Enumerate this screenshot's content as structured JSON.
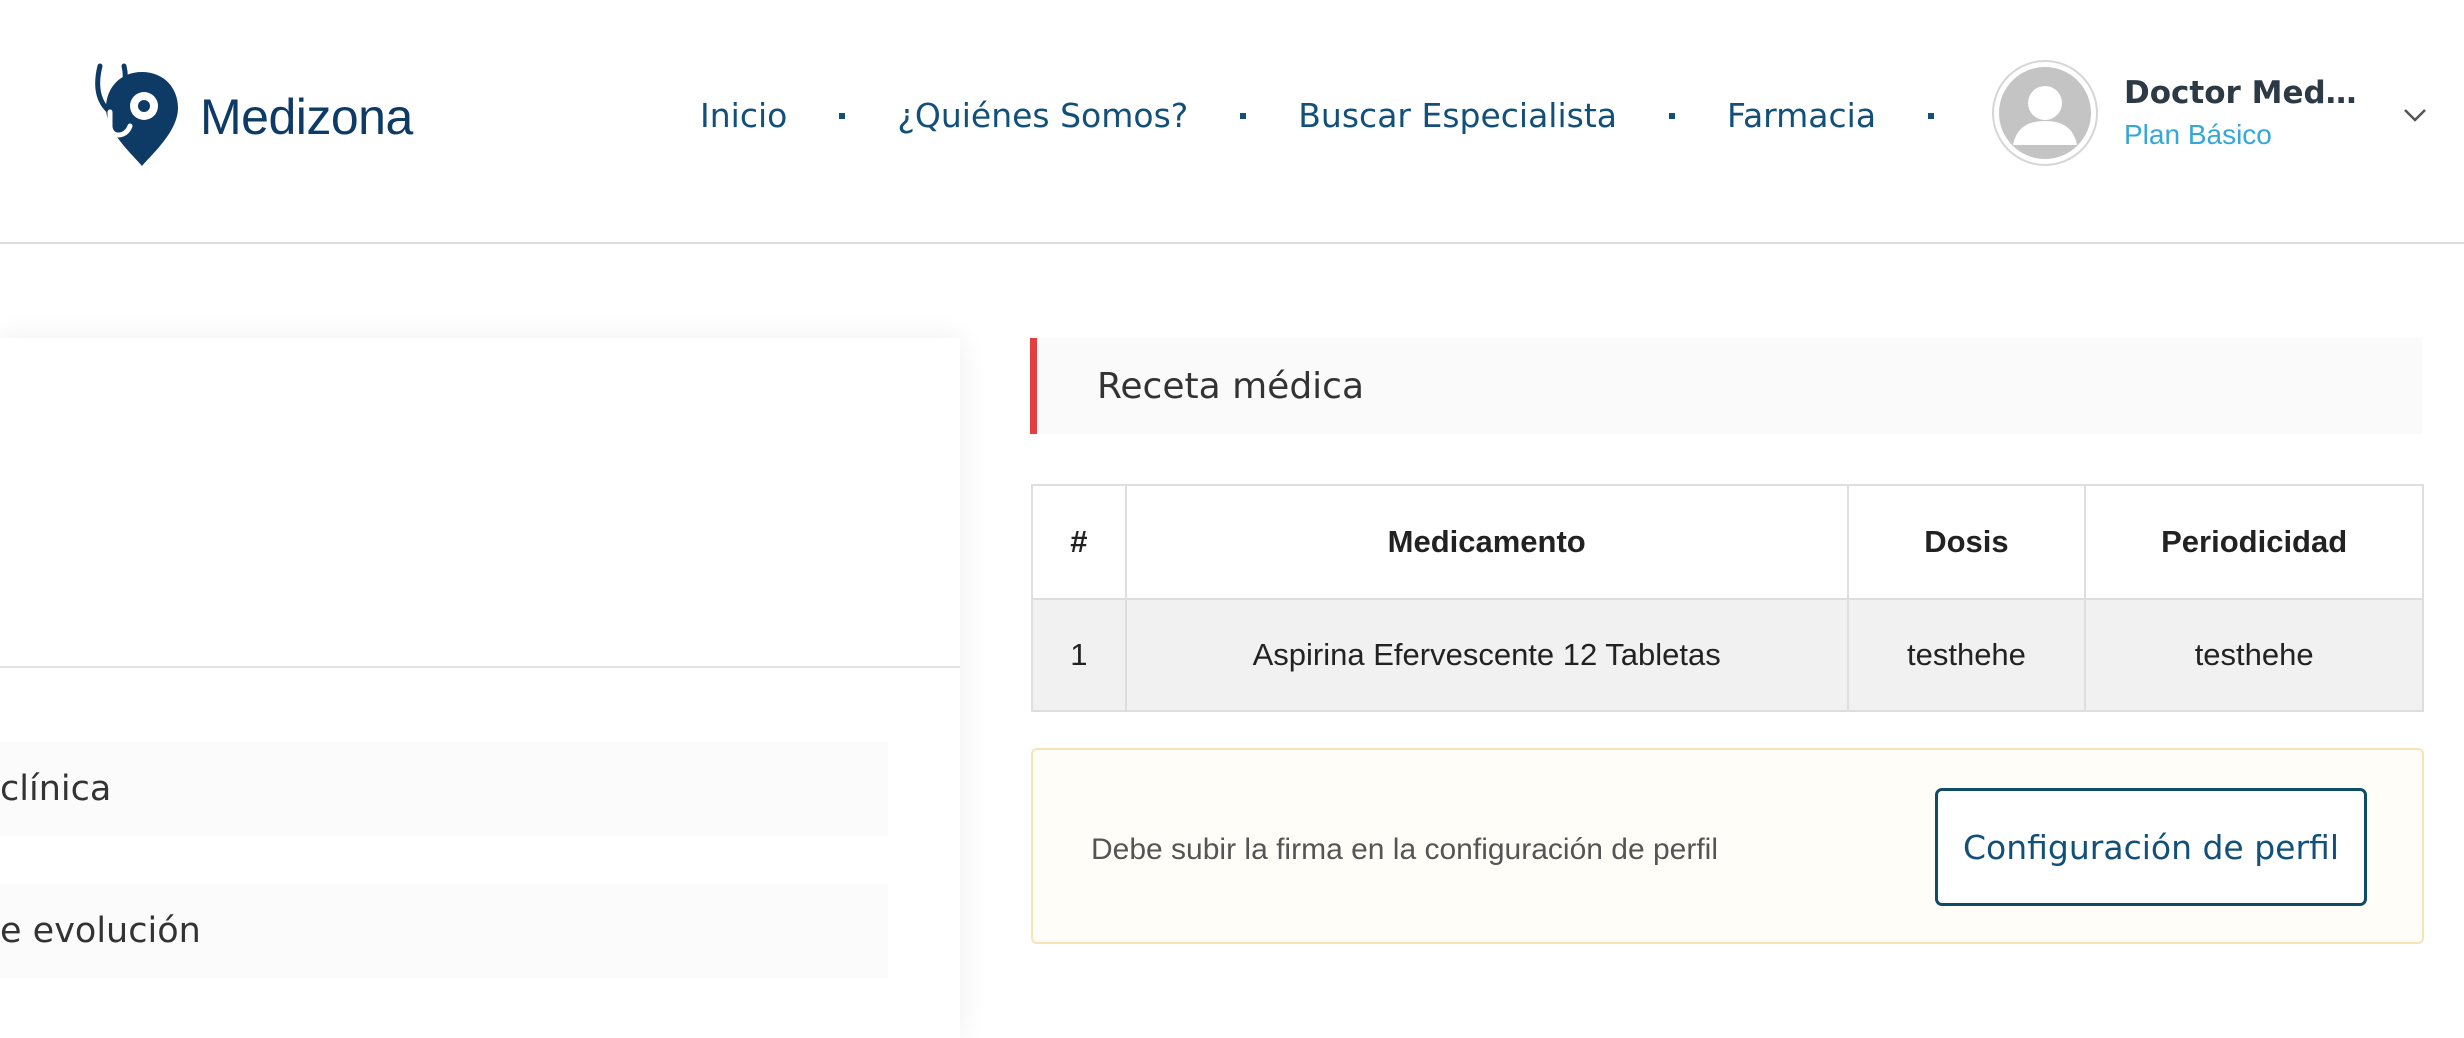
{
  "brand": {
    "name": "Medizona"
  },
  "nav": {
    "items": [
      "Inicio",
      "¿Quiénes Somos?",
      "Buscar Especialista",
      "Farmacia"
    ]
  },
  "user": {
    "name": "Doctor Medi...",
    "plan": "Plan Básico"
  },
  "left_panel": {
    "items": [
      "clínica",
      "e evolución"
    ]
  },
  "recipe": {
    "title": "Receta médica",
    "columns": [
      "#",
      "Medicamento",
      "Dosis",
      "Periodicidad"
    ],
    "rows": [
      [
        "1",
        "Aspirina Efervescente 12 Tabletas",
        "testhehe",
        "testhehe"
      ]
    ]
  },
  "alert": {
    "message": "Debe subir la firma en la configuración de perfil",
    "button_label": "Configuración de perfil"
  },
  "colors": {
    "brand_dark": "#0d3b66",
    "nav_link": "#12507a",
    "plan_link": "#35a7d8",
    "accent_red": "#e53e3e",
    "alert_border": "#f6e3b8"
  }
}
